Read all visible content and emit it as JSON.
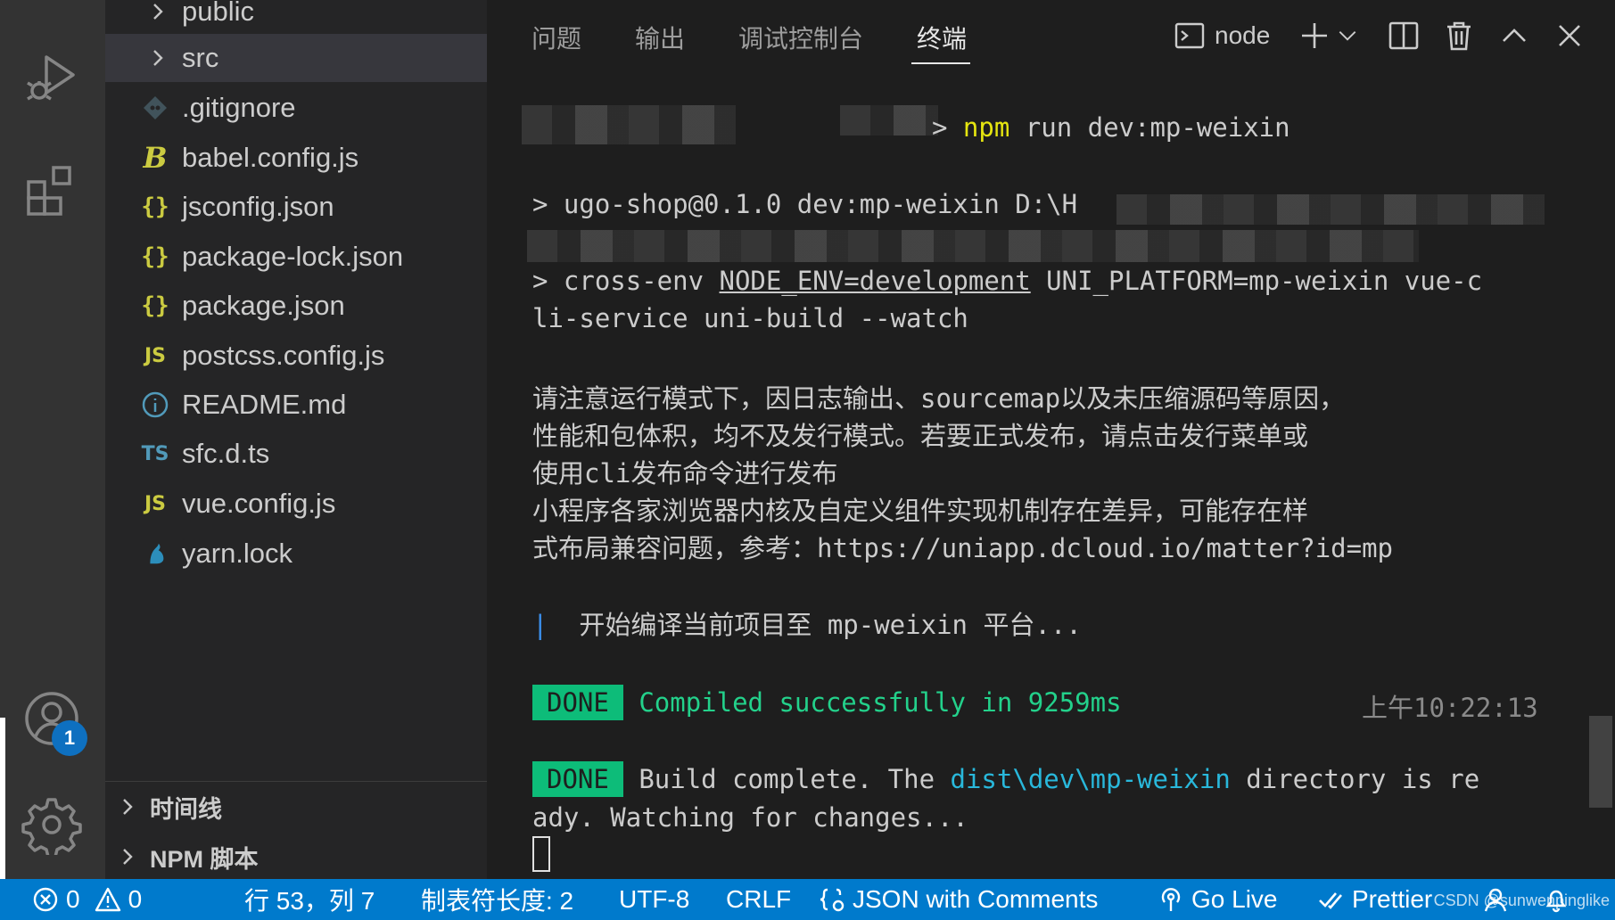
{
  "sidebar": {
    "items": [
      {
        "label": "public",
        "kind": "folder"
      },
      {
        "label": "src",
        "kind": "folder"
      },
      {
        "label": ".gitignore",
        "kind": "git"
      },
      {
        "label": "babel.config.js",
        "kind": "babel"
      },
      {
        "label": "jsconfig.json",
        "kind": "json",
        "glyph": "{}"
      },
      {
        "label": "package-lock.json",
        "kind": "json",
        "glyph": "{}"
      },
      {
        "label": "package.json",
        "kind": "json",
        "glyph": "{}"
      },
      {
        "label": "postcss.config.js",
        "kind": "js",
        "glyph": "JS"
      },
      {
        "label": "README.md",
        "kind": "info"
      },
      {
        "label": "sfc.d.ts",
        "kind": "ts",
        "glyph": "TS"
      },
      {
        "label": "vue.config.js",
        "kind": "js",
        "glyph": "JS"
      },
      {
        "label": "yarn.lock",
        "kind": "yarn"
      }
    ],
    "babel_glyph": "B",
    "sections": [
      {
        "label": "时间线"
      },
      {
        "label": "NPM 脚本"
      }
    ]
  },
  "activity": {
    "accounts_badge": "1"
  },
  "panel": {
    "tabs": [
      "问题",
      "输出",
      "调试控制台",
      "终端"
    ],
    "terminal_name": "node"
  },
  "terminal": {
    "cmd_prompt": "> ",
    "cmd_npm": "npm",
    "cmd_rest": " run dev:mp-weixin",
    "line2": "> ugo-shop@0.1.0 dev:mp-weixin D:\\H",
    "line3_a": "> cross-env ",
    "line3_env": "NODE_ENV=development",
    "line3_b": " UNI_PLATFORM=mp-weixin vue-c",
    "line4": "li-service uni-build --watch",
    "warn1": "请注意运行模式下，因日志输出、sourcemap以及未压缩源码等原因，",
    "warn2": "性能和包体积，均不及发行模式。若要正式发布，请点击发行菜单或",
    "warn3": "使用cli发布命令进行发布",
    "warn4": "小程序各家浏览器内核及自定义组件实现机制存在差异，可能存在样",
    "warn5": "式布局兼容问题，参考：https://uniapp.dcloud.io/matter?id=mp",
    "compile_bar": "|",
    "compile_text": "  开始编译当前项目至 mp-weixin 平台...",
    "done_label": "DONE",
    "compiled_msg": "Compiled successfully in 9259ms",
    "compiled_time": "上午10:22:13",
    "build_a": "Build complete. The ",
    "build_path": "dist\\dev\\mp-weixin",
    "build_b": " directory is re",
    "build_c": "ady. Watching for changes..."
  },
  "statusbar": {
    "errors": "0",
    "warnings": "0",
    "position": "行 53，列 7",
    "tab_size": "制表符长度: 2",
    "encoding": "UTF-8",
    "eol": "CRLF",
    "language": "JSON with Comments",
    "golive": "Go Live",
    "prettier": "Prettier"
  },
  "watermark": "CSDN @sunwenpinglike"
}
